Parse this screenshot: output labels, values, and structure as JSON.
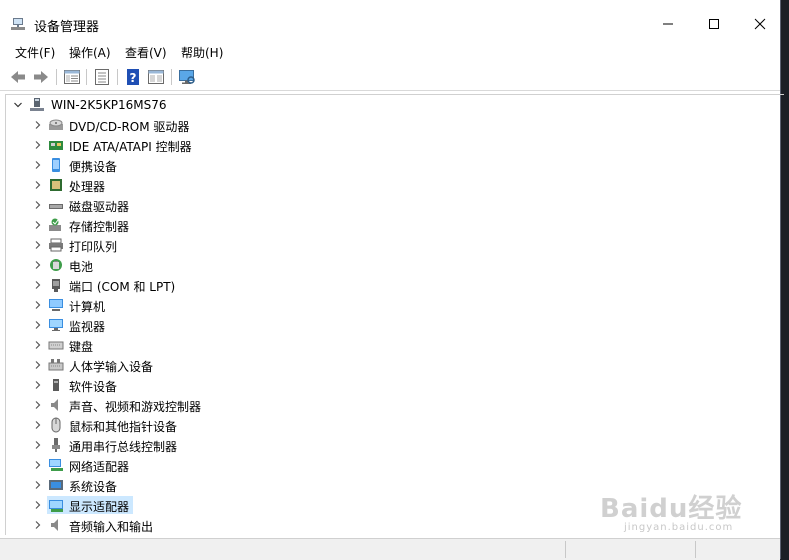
{
  "window": {
    "title": "设备管理器"
  },
  "menu": [
    {
      "label": "文件(F)"
    },
    {
      "label": "操作(A)"
    },
    {
      "label": "查看(V)"
    },
    {
      "label": "帮助(H)"
    }
  ],
  "tree": {
    "root": "WIN-2K5KP16MS76",
    "items": [
      {
        "label": "DVD/CD-ROM 驱动器",
        "icon": "dvd-drive-icon"
      },
      {
        "label": "IDE ATA/ATAPI 控制器",
        "icon": "ide-controller-icon"
      },
      {
        "label": "便携设备",
        "icon": "portable-device-icon"
      },
      {
        "label": "处理器",
        "icon": "processor-icon"
      },
      {
        "label": "磁盘驱动器",
        "icon": "disk-drive-icon"
      },
      {
        "label": "存储控制器",
        "icon": "storage-controller-icon"
      },
      {
        "label": "打印队列",
        "icon": "printer-icon"
      },
      {
        "label": "电池",
        "icon": "battery-icon"
      },
      {
        "label": "端口 (COM 和 LPT)",
        "icon": "port-icon"
      },
      {
        "label": "计算机",
        "icon": "computer-icon"
      },
      {
        "label": "监视器",
        "icon": "monitor-icon"
      },
      {
        "label": "键盘",
        "icon": "keyboard-icon"
      },
      {
        "label": "人体学输入设备",
        "icon": "hid-icon"
      },
      {
        "label": "软件设备",
        "icon": "software-device-icon"
      },
      {
        "label": "声音、视频和游戏控制器",
        "icon": "speaker-icon"
      },
      {
        "label": "鼠标和其他指针设备",
        "icon": "mouse-icon"
      },
      {
        "label": "通用串行总线控制器",
        "icon": "usb-icon"
      },
      {
        "label": "网络适配器",
        "icon": "network-adapter-icon"
      },
      {
        "label": "系统设备",
        "icon": "system-device-icon"
      },
      {
        "label": "显示适配器",
        "icon": "display-adapter-icon",
        "selected": true
      },
      {
        "label": "音频输入和输出",
        "icon": "audio-io-icon"
      }
    ]
  },
  "watermark": {
    "main": "Baidu经验",
    "sub": "jingyan.baidu.com"
  },
  "colors": {
    "selection": "#cce8ff",
    "accent": "#2b7bd3"
  }
}
